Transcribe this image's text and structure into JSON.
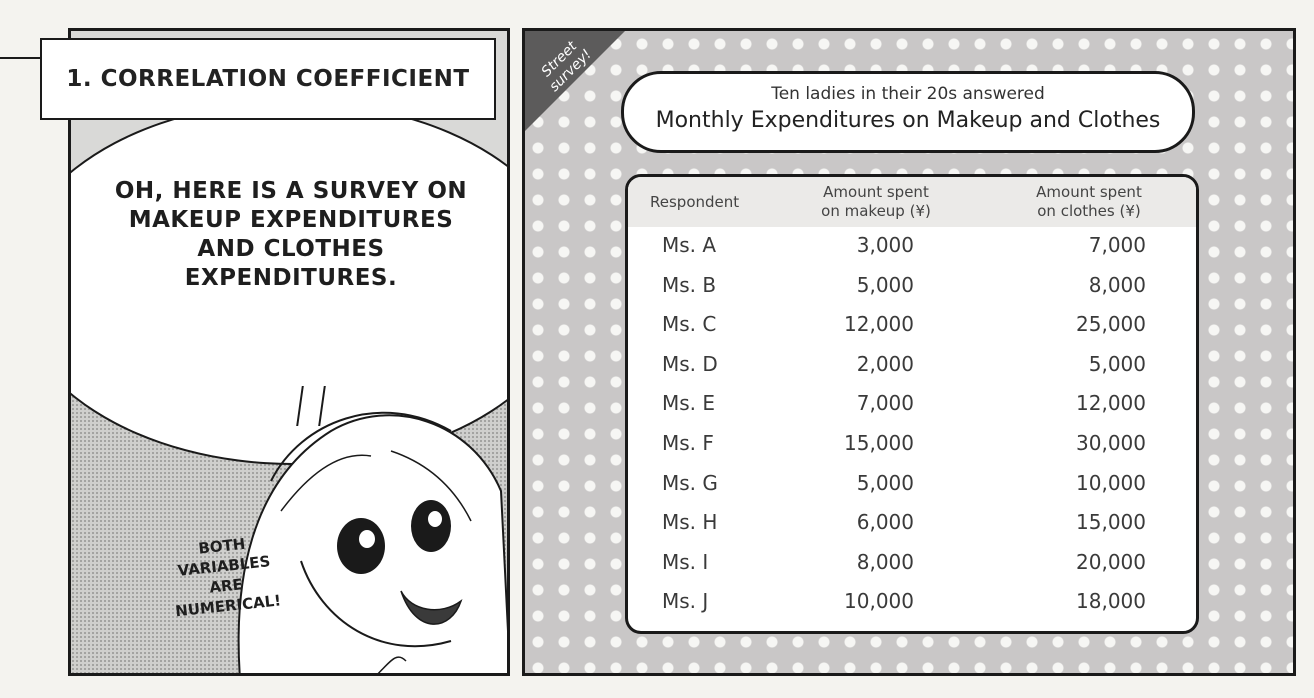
{
  "left_panel": {
    "title": "1. CORRELATION COEFFICIENT",
    "speech": [
      "OH, HERE IS A SURVEY ON",
      "MAKEUP EXPENDITURES",
      "AND CLOTHES",
      "EXPENDITURES."
    ],
    "side_note": [
      "BOTH",
      "VARIABLES",
      "ARE",
      "NUMERICAL!"
    ]
  },
  "right_panel": {
    "corner_label": [
      "Street",
      "survey!"
    ],
    "subtitle": "Ten ladies in their 20s answered",
    "title": "Monthly Expenditures on Makeup and Clothes",
    "table": {
      "headers": {
        "respondent": "Respondent",
        "makeup": [
          "Amount spent",
          "on makeup (¥)"
        ],
        "clothes": [
          "Amount spent",
          "on clothes (¥)"
        ]
      },
      "rows": [
        {
          "name": "Ms. A",
          "makeup": "3,000",
          "clothes": "7,000"
        },
        {
          "name": "Ms. B",
          "makeup": "5,000",
          "clothes": "8,000"
        },
        {
          "name": "Ms. C",
          "makeup": "12,000",
          "clothes": "25,000"
        },
        {
          "name": "Ms. D",
          "makeup": "2,000",
          "clothes": "5,000"
        },
        {
          "name": "Ms. E",
          "makeup": "7,000",
          "clothes": "12,000"
        },
        {
          "name": "Ms. F",
          "makeup": "15,000",
          "clothes": "30,000"
        },
        {
          "name": "Ms. G",
          "makeup": "5,000",
          "clothes": "10,000"
        },
        {
          "name": "Ms. H",
          "makeup": "6,000",
          "clothes": "15,000"
        },
        {
          "name": "Ms. I",
          "makeup": "8,000",
          "clothes": "20,000"
        },
        {
          "name": "Ms. J",
          "makeup": "10,000",
          "clothes": "18,000"
        }
      ]
    }
  }
}
